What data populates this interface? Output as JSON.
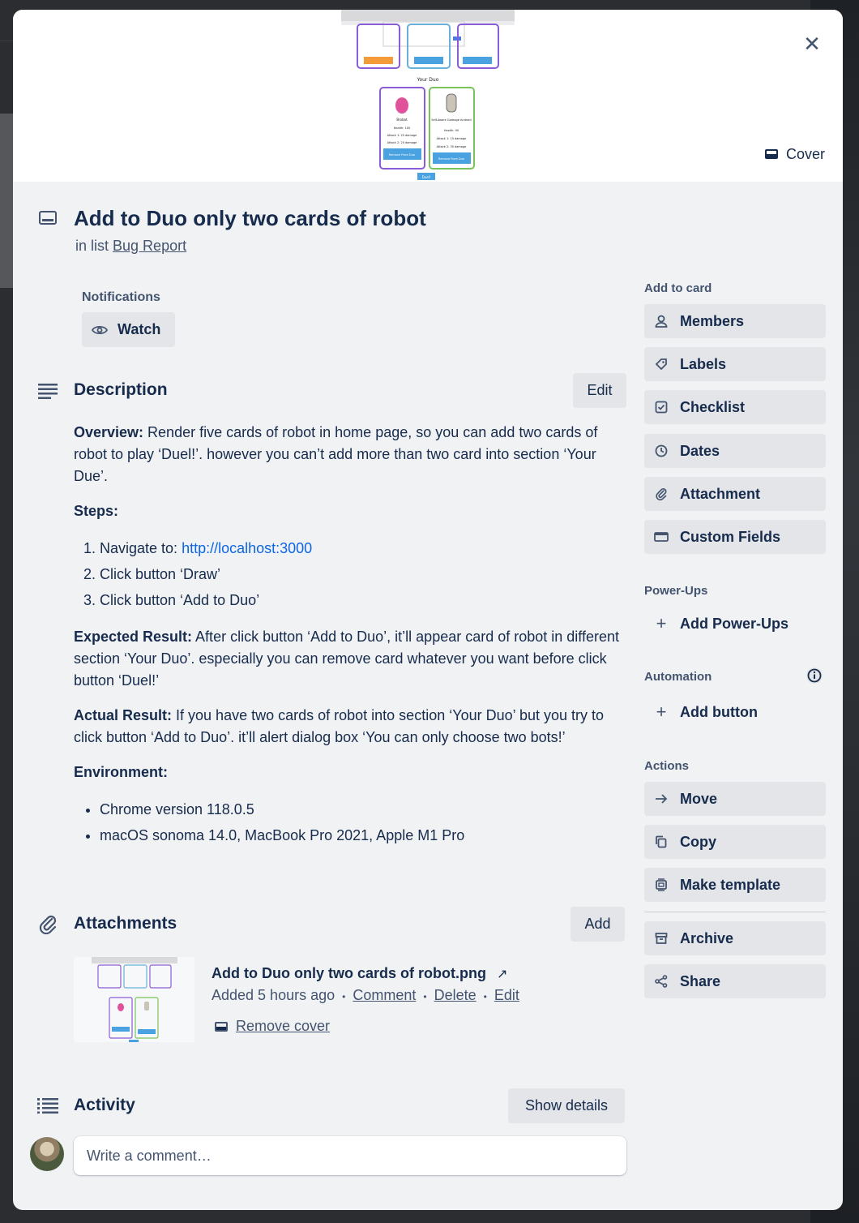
{
  "cover": {
    "button_label": "Cover",
    "close_glyph": "✕"
  },
  "card": {
    "title": "Add to Duo only two cards of robot",
    "in_list_prefix": "in list",
    "list_name": "Bug Report"
  },
  "notifications": {
    "label": "Notifications",
    "watch_label": "Watch"
  },
  "description": {
    "heading": "Description",
    "edit_label": "Edit",
    "overview_label": "Overview:",
    "overview_text": " Render five cards of robot in home page, so you can add two cards of robot to play ‘Duel!’. however you can’t add more than two card into section ‘Your Due’.",
    "steps_label": "Steps:",
    "step1_prefix": "Navigate to: ",
    "step1_link": "http://localhost:3000",
    "step2": "Click button ‘Draw’",
    "step3": "Click button ‘Add to Duo’",
    "expected_label": "Expected Result:",
    "expected_text": " After click button ‘Add to Duo’, it’ll appear card of robot in different section ‘Your Duo’. especially you can remove card whatever you want before click button ‘Duel!’",
    "actual_label": "Actual Result:",
    "actual_text": " If you have two cards of robot into section ‘Your Duo’ but you try to click button ‘Add to Duo’. it’ll alert dialog box ‘You can only choose two bots!’",
    "environment_label": "Environment:",
    "env1": "Chrome version 118.0.5",
    "env2": "macOS sonoma 14.0, MacBook Pro 2021, Apple M1 Pro"
  },
  "attachments": {
    "heading": "Attachments",
    "add_label": "Add",
    "file_name": "Add to Duo only two cards of robot.png",
    "file_arrow": "↗",
    "added_text": "Added 5 hours ago",
    "sep": "•",
    "comment_link": "Comment",
    "delete_link": "Delete",
    "edit_link": "Edit",
    "remove_cover": "Remove cover"
  },
  "activity": {
    "heading": "Activity",
    "show_details": "Show details",
    "comment_placeholder": "Write a comment…"
  },
  "sidebar": {
    "add_to_card_label": "Add to card",
    "members": "Members",
    "labels": "Labels",
    "checklist": "Checklist",
    "dates": "Dates",
    "attachment": "Attachment",
    "custom_fields": "Custom Fields",
    "powerups_label": "Power-Ups",
    "add_powerups": "Add Power-Ups",
    "automation_label": "Automation",
    "add_button": "Add button",
    "actions_label": "Actions",
    "move": "Move",
    "copy": "Copy",
    "make_template": "Make template",
    "archive": "Archive",
    "share": "Share"
  },
  "cover_preview": {
    "section_title": "Your Duo",
    "bot1_name": "Brobot",
    "bot1_health": "Health: 100",
    "bot1_attack1": "Attack 1: 25 damage",
    "bot1_attack2": "Attack 2: 20 damage",
    "bot1_btn": "Remove From Duo",
    "bot2_name": "Self-Aware Garbage Android",
    "bot2_health": "Health: 90",
    "bot2_attack1": "Attack 1: 15 damage",
    "bot2_attack2": "Attack 2: 35 damage",
    "bot2_btn": "Remove From Duo",
    "duel_btn": "Duel!",
    "add_btn": "Add To Duo"
  },
  "colors": {
    "link": "#0c66e4",
    "button_bg": "#e3e5e8",
    "modal_bg": "#f1f2f4"
  }
}
